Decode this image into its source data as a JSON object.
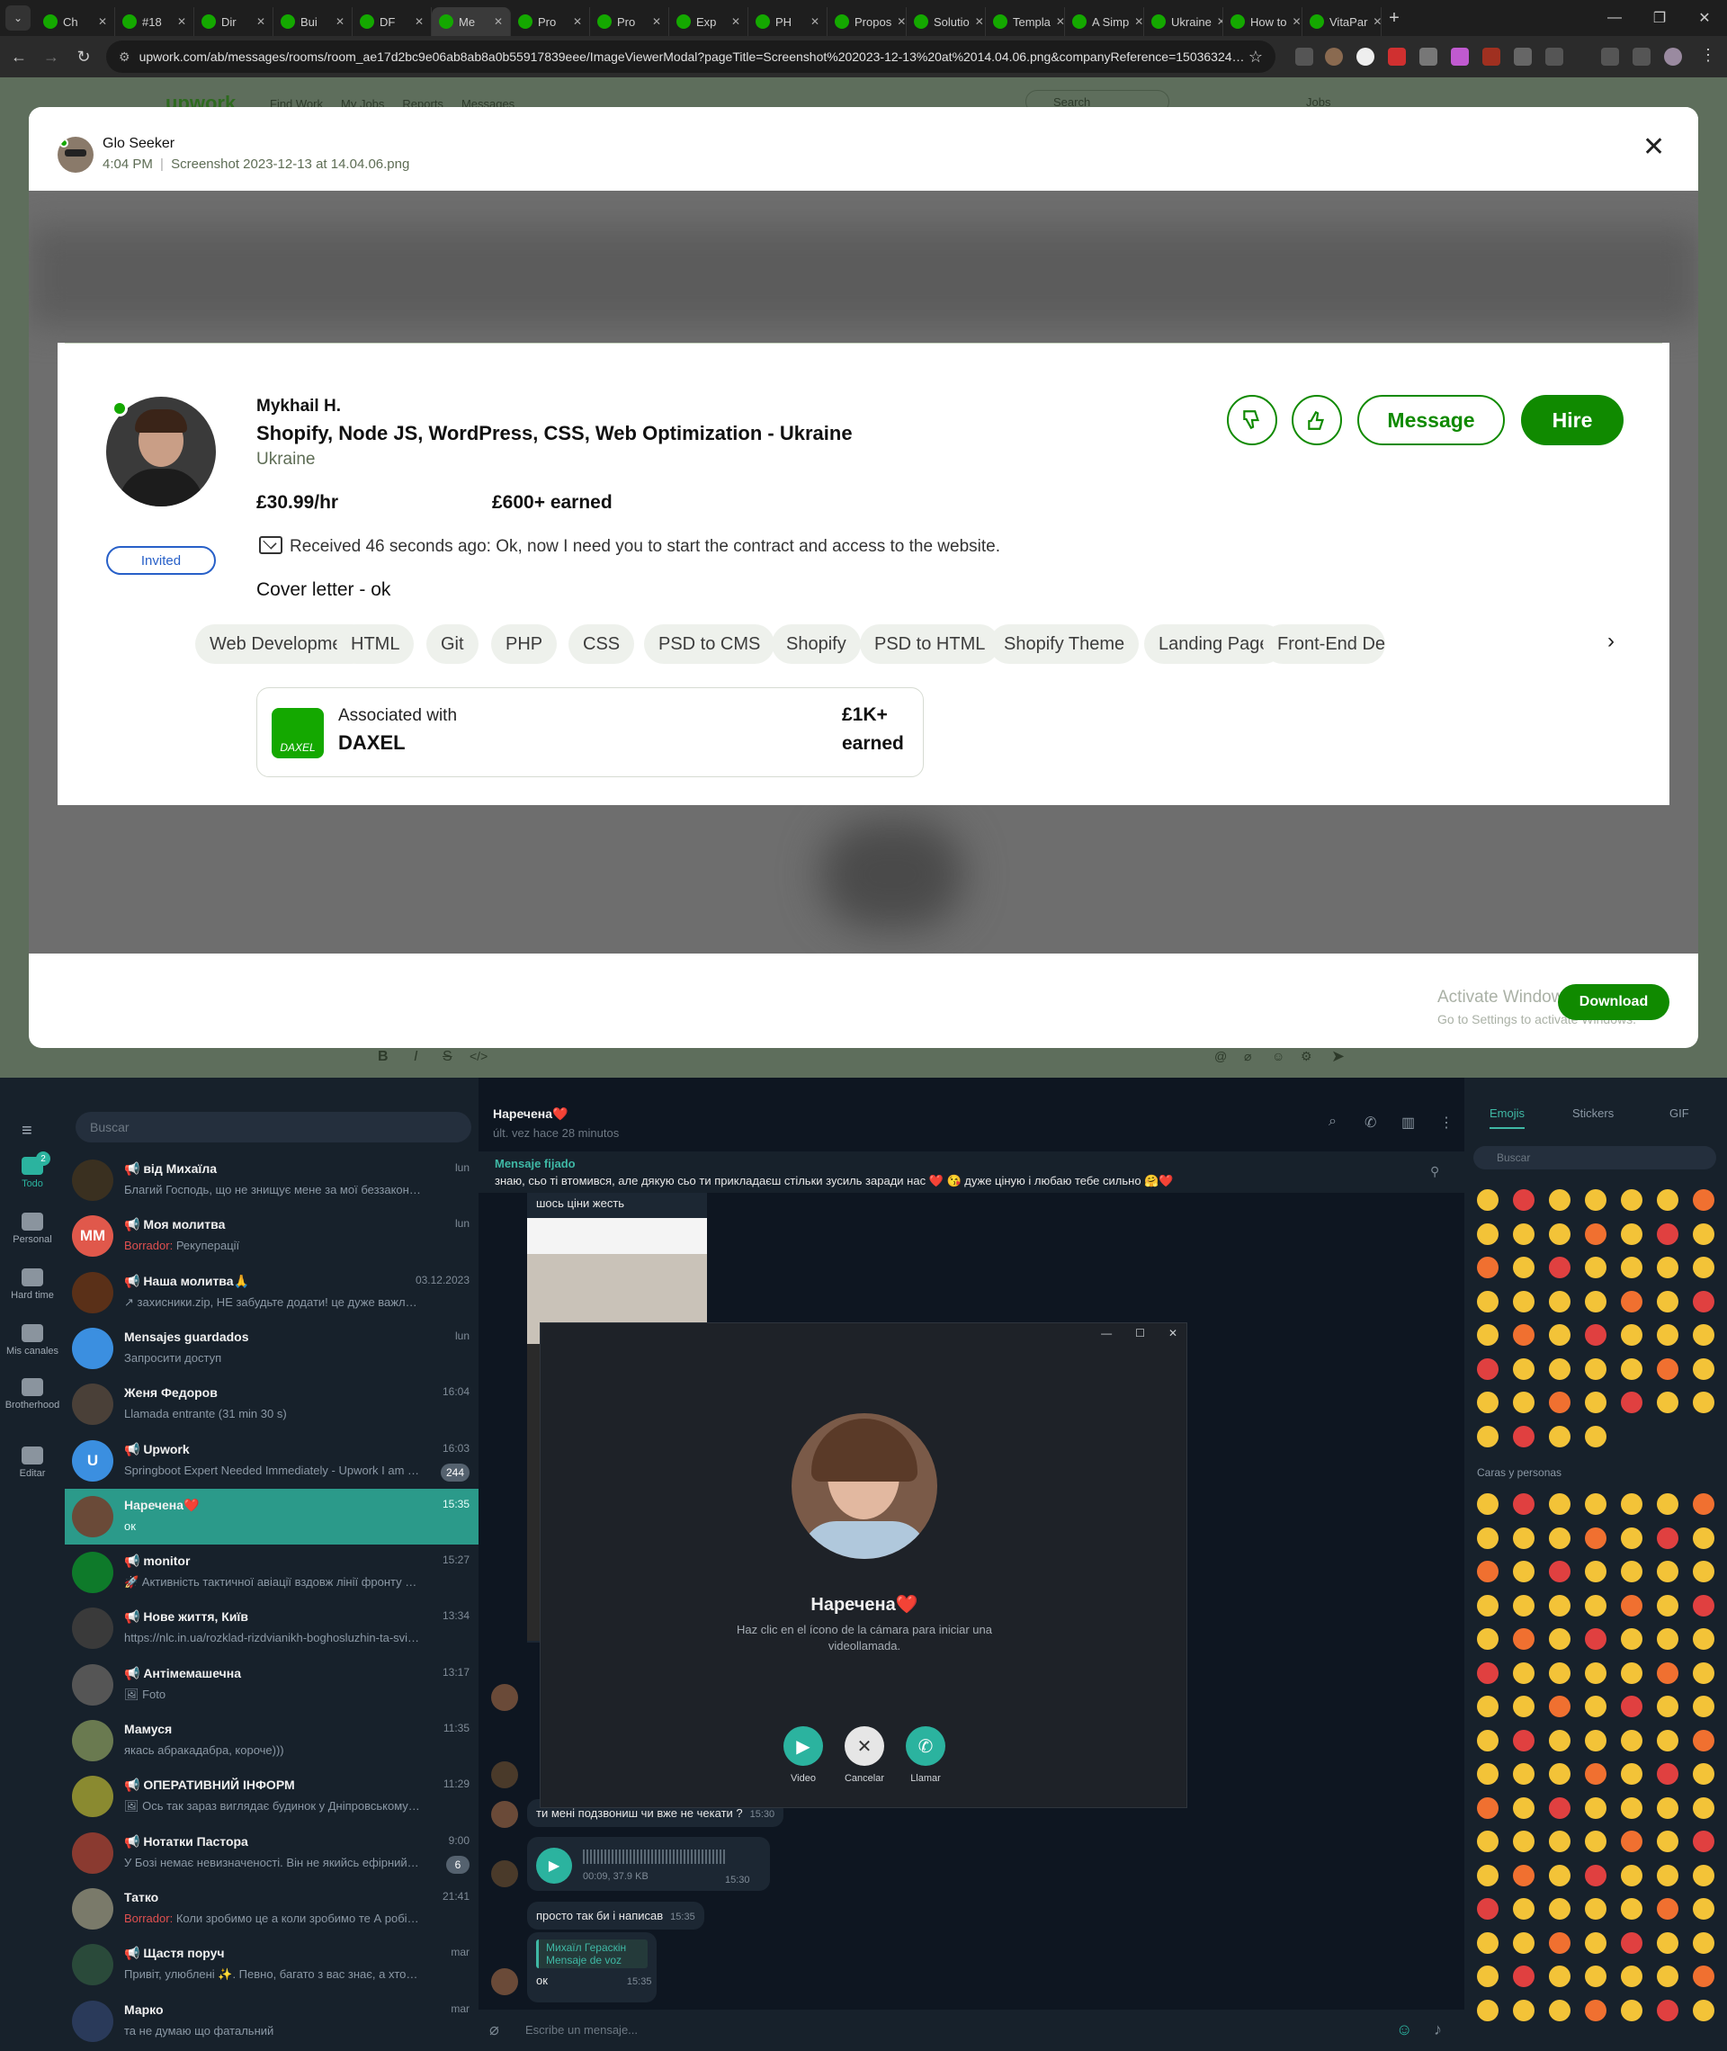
{
  "browser": {
    "tabs": [
      "Ch",
      "#18",
      "Dir",
      "Bui",
      "DF",
      "Me",
      "Pro",
      "Pro",
      "Exp",
      "PH",
      "Propos",
      "Solutio",
      "Templa",
      "A Simp",
      "Ukraine",
      "How to",
      "VitaPar"
    ],
    "active_tab_index": 5,
    "url": "upwork.com/ab/messages/rooms/room_ae17d2bc9e06ab8ab8a0b55917839eee/ImageViewerModal?pageTitle=Screenshot%202023-12-13%20at%2014.04.06.png&companyReference=1503632411..."
  },
  "upwork_nav": {
    "logo": "upwork",
    "items": [
      "Find Work",
      "My Jobs",
      "Reports",
      "Messages"
    ],
    "search": "Search",
    "jobs": "Jobs"
  },
  "modal": {
    "sender": "Glo Seeker",
    "time": "4:04 PM",
    "filename": "Screenshot 2023-12-13 at 14.04.06.png",
    "download_label": "Download",
    "activate_title": "Activate Windows",
    "activate_sub": "Go to Settings to activate Windows."
  },
  "profile": {
    "name": "Mykhail H.",
    "title": "Shopify, Node JS, WordPress, CSS, Web Optimization - Ukraine",
    "country": "Ukraine",
    "rate": "£30.99/hr",
    "earned": "£600+ earned",
    "invited": "Invited",
    "received": "Received 46 seconds ago: Ok, now I need you to start the contract and access to the website.",
    "cover": "Cover letter - ok",
    "message_btn": "Message",
    "hire_btn": "Hire",
    "skills": [
      "Web Development",
      "HTML",
      "Git",
      "PHP",
      "CSS",
      "PSD to CMS",
      "Shopify",
      "PSD to HTML",
      "Shopify Theme",
      "Landing Page",
      "Front-End Develo"
    ],
    "assoc_label": "Associated with",
    "assoc_name": "DAXEL",
    "assoc_logo": "DAXEL",
    "assoc_earned_1": "£1K+",
    "assoc_earned_2": "earned"
  },
  "telegram": {
    "search": "Buscar",
    "rail": [
      "Todo",
      "Personal",
      "Hard time",
      "Mis canales",
      "Brotherhood",
      "Editar"
    ],
    "rail_badge": "2",
    "chats": [
      {
        "name": "📢 від Михаїла",
        "preview": "Благий Господь, що не знищує мене за мої беззаконня...",
        "time": "lun",
        "color": "#3a3020"
      },
      {
        "name": "📢 Моя молитва",
        "draft": "Borrador:",
        "preview": "Рекуперації",
        "time": "lun",
        "initials": "MM",
        "color": "#e0584b"
      },
      {
        "name": "📢 Наша молитва🙏",
        "preview": "↗ захисники.zip, НЕ забудьте додати! це дуже важливо ...",
        "time": "03.12.2023",
        "color": "#5a3018"
      },
      {
        "name": "Mensajes guardados",
        "preview": "Запросити доступ",
        "time": "lun",
        "color": "#3b8fe0"
      },
      {
        "name": "Женя Федоров",
        "preview": "Llamada entrante (31 min 30 s)",
        "time": "16:04",
        "color": "#4a4038"
      },
      {
        "name": "📢 Upwork",
        "preview": "Springboot Expert Needed Immediately - Upwork I am b...",
        "time": "16:03",
        "badge": "244",
        "initials": "U",
        "color": "#3b8fe0"
      },
      {
        "name": "Наречена❤️",
        "preview": "ок",
        "time": "15:35",
        "color": "#6a4a38"
      },
      {
        "name": "📢 monitor",
        "preview": "🚀 Активність тактичної авіації вздовж лінії фронту на Півд...",
        "time": "15:27",
        "color": "#0e7a2a"
      },
      {
        "name": "📢 Нове життя, Київ",
        "preview": "https://nlc.in.ua/rozklad-rizdvianikh-boghosluzhin-ta-sviatkovi...",
        "time": "13:34",
        "color": "#3a3a3a"
      },
      {
        "name": "📢 Антімемашечна",
        "preview": "🖼 Foto",
        "time": "13:17",
        "color": "#555555"
      },
      {
        "name": "Мамуся",
        "preview": "якась абракадабра, короче)))",
        "time": "11:35",
        "color": "#6a7a50"
      },
      {
        "name": "📢 ОПЕРАТИВНИЙ ІНФОРМ",
        "preview": "🖼 Ось так зараз виглядає будинок у Дніпровському район...",
        "time": "11:29",
        "color": "#8a8a30"
      },
      {
        "name": "📢 Нотатки Пастора",
        "preview": "У Бозі немає невизначеності. Він не якийсь ефірний та н...",
        "time": "9:00",
        "badge": "6",
        "color": "#8a3a30"
      },
      {
        "name": "Татко",
        "draft": "Borrador:",
        "preview": "Коли зробимо це а коли зробимо те  А робітники ...",
        "time": "21:41",
        "color": "#7a7a6a"
      },
      {
        "name": "📢 Щастя поруч",
        "preview": "Привіт, улюблені ✨. Певно, багато з вас знає, а хтось в цьо...",
        "time": "mar",
        "color": "#2a4a3a"
      },
      {
        "name": "Марко",
        "preview": "та не думаю що фатальний",
        "time": "mar",
        "color": "#2a3a5a"
      }
    ],
    "conv_title": "Наречена❤️",
    "conv_status": "últ. vez hace 28 minutos",
    "pinned_label": "Mensaje fijado",
    "pinned_text": "знаю, сьо ті втомився, але дякую сьо ти прикладаєш стільки зусиль заради нас ❤️ 😘 дуже ціную і любаю тебе сильно 🤗❤️",
    "img_caption": "шось ціни жесть",
    "msg1": "ти мені подзвониш чи вже не чекати ?",
    "msg1_time": "15:30",
    "voice_info": "00:09, 37.9 KB",
    "voice_time": "15:30",
    "msg2": "просто так би і написав",
    "msg2_time": "15:35",
    "reply_name": "Михаїл Гераскін",
    "reply_text": "Mensaje de voz",
    "msg3": "ок",
    "msg3_time": "15:35",
    "input_placeholder": "Escribe un mensaje...",
    "call": {
      "name": "Наречена❤️",
      "hint": "Haz clic en el ícono de la cámara para iniciar una videollamada.",
      "video": "Video",
      "cancel": "Cancelar",
      "call": "Llamar"
    },
    "emoji_tabs": [
      "Emojis",
      "Stickers",
      "GIF"
    ],
    "emoji_search": "Buscar",
    "emoji_section": "Caras y personas"
  },
  "colors": {
    "upwork_green": "#14a800",
    "upwork_dark": "#108a00",
    "tg_accent": "#2b9a8a",
    "tg_panel": "#17212b"
  }
}
